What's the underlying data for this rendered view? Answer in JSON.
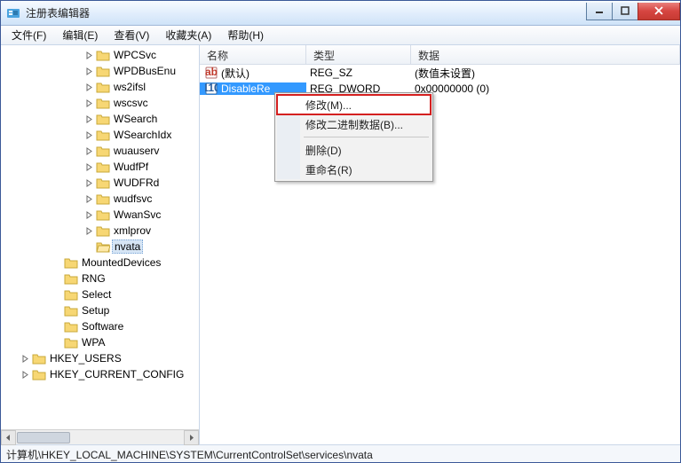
{
  "title": "注册表编辑器",
  "menu": {
    "file": "文件(F)",
    "edit": "编辑(E)",
    "view": "查看(V)",
    "favorites": "收藏夹(A)",
    "help": "帮助(H)"
  },
  "tree": {
    "items_a": [
      "WPCSvc",
      "WPDBusEnu",
      "ws2ifsl",
      "wscsvc",
      "WSearch",
      "WSearchIdx",
      "wuauserv",
      "WudfPf",
      "WUDFRd",
      "wudfsvc",
      "WwanSvc",
      "xmlprov"
    ],
    "selected": "nvata",
    "items_b": [
      "MountedDevices",
      "RNG",
      "Select",
      "Setup",
      "Software",
      "WPA"
    ],
    "items_c": [
      "HKEY_USERS",
      "HKEY_CURRENT_CONFIG"
    ]
  },
  "columns": {
    "name": "名称",
    "type": "类型",
    "data": "数据"
  },
  "rows": [
    {
      "name": "(默认)",
      "type": "REG_SZ",
      "data": "(数值未设置)",
      "icon": "string"
    },
    {
      "name": "DisableRe",
      "type": "REG_DWORD",
      "data": "0x00000000 (0)",
      "icon": "dword",
      "selected": true
    }
  ],
  "ctx": {
    "modify": "修改(M)...",
    "modbin": "修改二进制数据(B)...",
    "delete": "删除(D)",
    "rename": "重命名(R)"
  },
  "status": "计算机\\HKEY_LOCAL_MACHINE\\SYSTEM\\CurrentControlSet\\services\\nvata"
}
